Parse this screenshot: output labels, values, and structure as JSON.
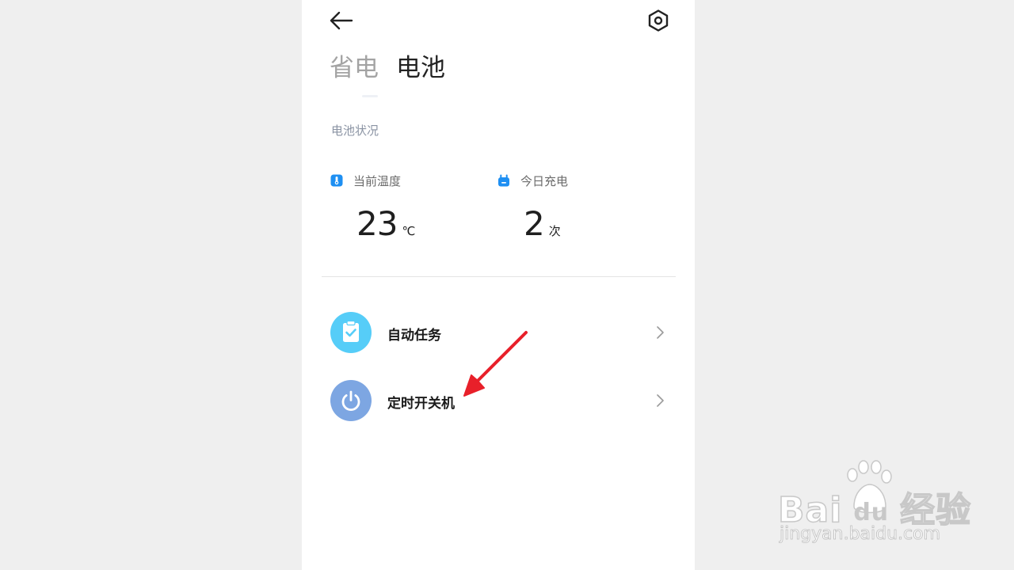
{
  "header": {
    "back_icon": "arrow-left-icon",
    "settings_icon": "hexagon-gear-icon"
  },
  "tabs": [
    {
      "label": "省电",
      "active": false
    },
    {
      "label": "电池",
      "active": true
    }
  ],
  "battery_status": {
    "section_label": "电池状况",
    "temperature": {
      "label": "当前温度",
      "value": "23",
      "unit": "℃",
      "icon": "thermometer-icon",
      "icon_color": "#1e8ff2"
    },
    "charge_today": {
      "label": "今日充电",
      "value": "2",
      "unit": "次",
      "icon": "charger-plug-icon",
      "icon_color": "#1e8ff2"
    }
  },
  "list_items": [
    {
      "label": "自动任务",
      "icon": "clipboard-check-icon",
      "icon_bg": "#56cdf8"
    },
    {
      "label": "定时开关机",
      "icon": "power-icon",
      "icon_bg": "#7da6e2"
    }
  ],
  "annotation": {
    "color": "#e8202a",
    "shape": "red-arrow"
  },
  "watermark": {
    "brand": "Bai經驗",
    "brand_parts": [
      "Bai",
      "du",
      "经验"
    ],
    "url": "jingyan.baidu.com"
  }
}
